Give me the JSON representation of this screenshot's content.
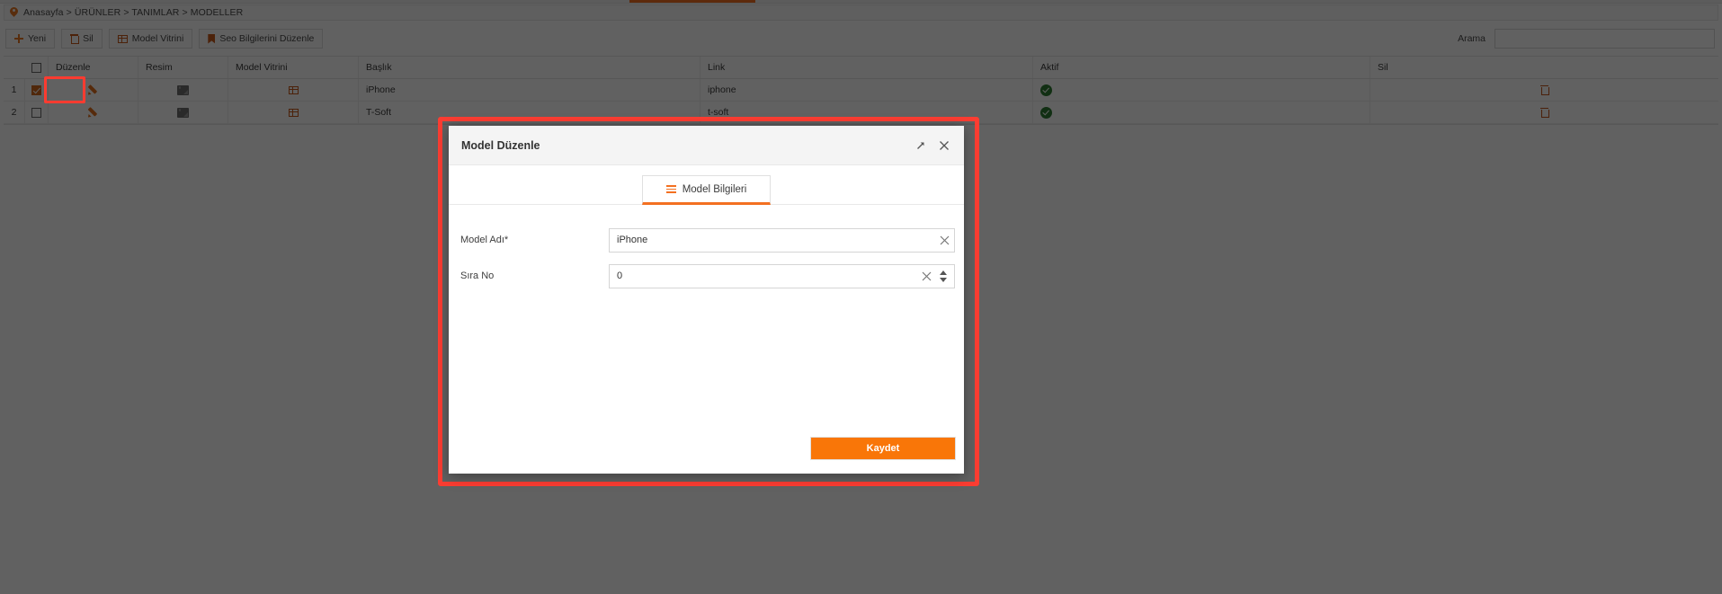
{
  "breadcrumb": {
    "icon": "location-pin-icon",
    "text": "Anasayfa > ÜRÜNLER > TANIMLAR > MODELLER"
  },
  "toolbar": {
    "buttons": [
      {
        "label": "Yeni",
        "icon": "plus-icon"
      },
      {
        "label": "Sil",
        "icon": "trash-icon"
      },
      {
        "label": "Model Vitrini",
        "icon": "grid-icon"
      },
      {
        "label": "Seo Bilgilerini Düzenle",
        "icon": "bookmark-icon"
      }
    ]
  },
  "search": {
    "label": "Arama",
    "value": "",
    "placeholder": ""
  },
  "grid": {
    "columns": [
      {
        "key": "num",
        "label": ""
      },
      {
        "key": "check",
        "label": ""
      },
      {
        "key": "edit",
        "label": "Düzenle"
      },
      {
        "key": "resim",
        "label": "Resim"
      },
      {
        "key": "vitrin",
        "label": "Model Vitrini"
      },
      {
        "key": "baslik",
        "label": "Başlık"
      },
      {
        "key": "link",
        "label": "Link"
      },
      {
        "key": "aktif",
        "label": "Aktif"
      },
      {
        "key": "sil",
        "label": "Sil"
      }
    ],
    "rows": [
      {
        "num": "1",
        "selected": true,
        "edit_icon": "pencil-icon",
        "resim_icon": "image-placeholder-icon",
        "vitrin_icon": "grid-icon",
        "baslik": "iPhone",
        "link": "iphone",
        "aktif_icon": "check-circle-icon",
        "sil_icon": "trash-icon"
      },
      {
        "num": "2",
        "selected": false,
        "edit_icon": "pencil-icon",
        "resim_icon": "image-placeholder-icon",
        "vitrin_icon": "grid-icon",
        "baslik": "T-Soft",
        "link": "t-soft",
        "aktif_icon": "check-circle-icon",
        "sil_icon": "trash-icon"
      }
    ]
  },
  "modal": {
    "title": "Model Düzenle",
    "expand_icon": "expand-arrow-icon",
    "close_icon": "close-icon",
    "tabs": [
      {
        "label": "Model Bilgileri",
        "icon": "hamburger-icon",
        "active": true
      }
    ],
    "fields": [
      {
        "label": "Model Adı*",
        "value": "iPhone",
        "placeholder": "",
        "type": "text",
        "clear_icon": "close-icon"
      },
      {
        "label": "Sıra No",
        "value": "0",
        "placeholder": "",
        "type": "number",
        "clear_icon": "close-icon",
        "spinner_icon": "spinner-up-down-icon"
      }
    ],
    "save_label": "Kaydet"
  },
  "colors": {
    "accent_orange": "#f37021",
    "save_button": "#f97608",
    "highlight_red": "#fc3d32",
    "active_green": "#2f7d32",
    "icon_brown": "#c4551c",
    "overlay": "rgba(0,0,0,0.62)"
  }
}
